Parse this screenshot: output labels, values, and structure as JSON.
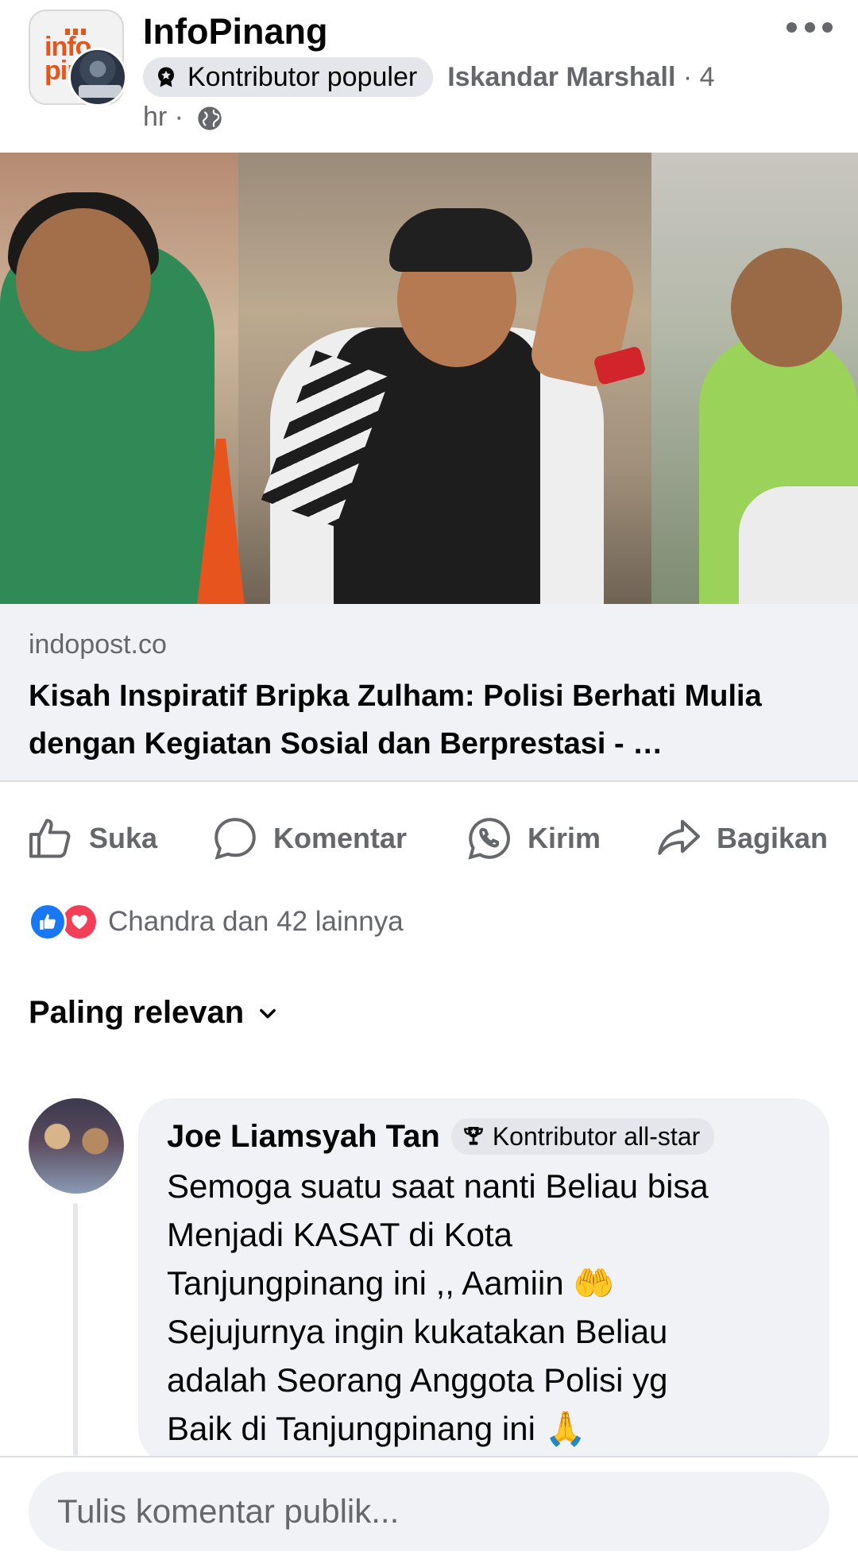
{
  "post": {
    "page_name": "InfoPinang",
    "page_logo_text": "info pin",
    "badge_label": "Kontributor populer",
    "author": "Iskandar Marshall",
    "time_prefix": "· 4",
    "time_suffix": "hr ·",
    "more_icon": "more-horizontal-icon",
    "privacy_icon": "globe-icon"
  },
  "link": {
    "domain": "indopost.co",
    "title": "Kisah Inspiratif Bripka Zulham: Polisi Berhati Mulia dengan Kegiatan Sosial dan Berprestasi - …"
  },
  "actions": [
    {
      "label": "Suka",
      "icon": "thumbs-up-icon"
    },
    {
      "label": "Komentar",
      "icon": "comment-icon"
    },
    {
      "label": "Kirim",
      "icon": "whatsapp-icon"
    },
    {
      "label": "Bagikan",
      "icon": "share-icon"
    }
  ],
  "reactions": {
    "summary": "Chandra dan 42 lainnya",
    "icons": [
      "like-reaction-icon",
      "love-reaction-icon"
    ],
    "colors": {
      "like": "#1877f2",
      "love": "#f33e58"
    }
  },
  "sort": {
    "label": "Paling relevan"
  },
  "comment": {
    "name": "Joe Liamsyah Tan",
    "badge": "Kontributor all-star",
    "text": "Semoga suatu saat nanti Beliau bisa\nMenjadi KASAT di Kota\nTanjungpinang ini ,, Aamiin 🤲\nSejujurnya ingin kukatakan Beliau\nadalah Seorang Anggota Polisi yg\nBaik di Tanjungpinang ini 🙏"
  },
  "composer": {
    "placeholder": "Tulis komentar publik..."
  },
  "colors": {
    "secondary_text": "#65676b",
    "surface": "#f0f2f5",
    "badge_bg": "#e4e6eb"
  }
}
